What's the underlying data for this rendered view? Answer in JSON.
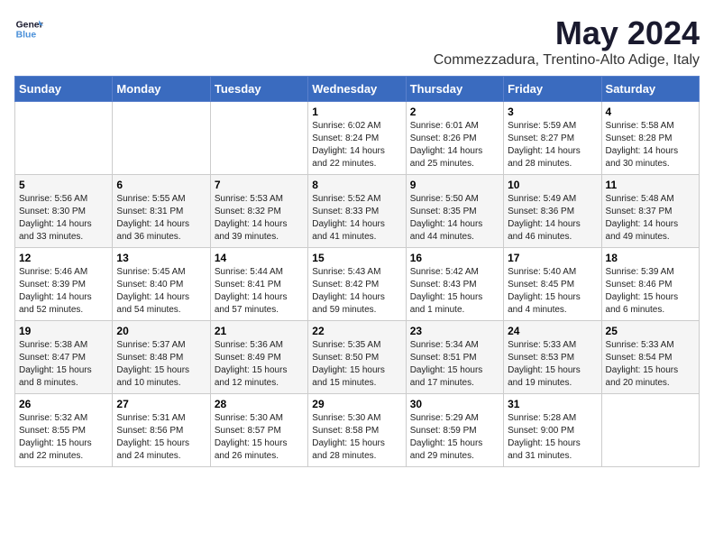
{
  "logo": {
    "line1": "General",
    "line2": "Blue"
  },
  "title": {
    "month": "May 2024",
    "location": "Commezzadura, Trentino-Alto Adige, Italy"
  },
  "days_header": [
    "Sunday",
    "Monday",
    "Tuesday",
    "Wednesday",
    "Thursday",
    "Friday",
    "Saturday"
  ],
  "weeks": [
    [
      {
        "day": "",
        "info": ""
      },
      {
        "day": "",
        "info": ""
      },
      {
        "day": "",
        "info": ""
      },
      {
        "day": "1",
        "info": "Sunrise: 6:02 AM\nSunset: 8:24 PM\nDaylight: 14 hours and 22 minutes."
      },
      {
        "day": "2",
        "info": "Sunrise: 6:01 AM\nSunset: 8:26 PM\nDaylight: 14 hours and 25 minutes."
      },
      {
        "day": "3",
        "info": "Sunrise: 5:59 AM\nSunset: 8:27 PM\nDaylight: 14 hours and 28 minutes."
      },
      {
        "day": "4",
        "info": "Sunrise: 5:58 AM\nSunset: 8:28 PM\nDaylight: 14 hours and 30 minutes."
      }
    ],
    [
      {
        "day": "5",
        "info": "Sunrise: 5:56 AM\nSunset: 8:30 PM\nDaylight: 14 hours and 33 minutes."
      },
      {
        "day": "6",
        "info": "Sunrise: 5:55 AM\nSunset: 8:31 PM\nDaylight: 14 hours and 36 minutes."
      },
      {
        "day": "7",
        "info": "Sunrise: 5:53 AM\nSunset: 8:32 PM\nDaylight: 14 hours and 39 minutes."
      },
      {
        "day": "8",
        "info": "Sunrise: 5:52 AM\nSunset: 8:33 PM\nDaylight: 14 hours and 41 minutes."
      },
      {
        "day": "9",
        "info": "Sunrise: 5:50 AM\nSunset: 8:35 PM\nDaylight: 14 hours and 44 minutes."
      },
      {
        "day": "10",
        "info": "Sunrise: 5:49 AM\nSunset: 8:36 PM\nDaylight: 14 hours and 46 minutes."
      },
      {
        "day": "11",
        "info": "Sunrise: 5:48 AM\nSunset: 8:37 PM\nDaylight: 14 hours and 49 minutes."
      }
    ],
    [
      {
        "day": "12",
        "info": "Sunrise: 5:46 AM\nSunset: 8:39 PM\nDaylight: 14 hours and 52 minutes."
      },
      {
        "day": "13",
        "info": "Sunrise: 5:45 AM\nSunset: 8:40 PM\nDaylight: 14 hours and 54 minutes."
      },
      {
        "day": "14",
        "info": "Sunrise: 5:44 AM\nSunset: 8:41 PM\nDaylight: 14 hours and 57 minutes."
      },
      {
        "day": "15",
        "info": "Sunrise: 5:43 AM\nSunset: 8:42 PM\nDaylight: 14 hours and 59 minutes."
      },
      {
        "day": "16",
        "info": "Sunrise: 5:42 AM\nSunset: 8:43 PM\nDaylight: 15 hours and 1 minute."
      },
      {
        "day": "17",
        "info": "Sunrise: 5:40 AM\nSunset: 8:45 PM\nDaylight: 15 hours and 4 minutes."
      },
      {
        "day": "18",
        "info": "Sunrise: 5:39 AM\nSunset: 8:46 PM\nDaylight: 15 hours and 6 minutes."
      }
    ],
    [
      {
        "day": "19",
        "info": "Sunrise: 5:38 AM\nSunset: 8:47 PM\nDaylight: 15 hours and 8 minutes."
      },
      {
        "day": "20",
        "info": "Sunrise: 5:37 AM\nSunset: 8:48 PM\nDaylight: 15 hours and 10 minutes."
      },
      {
        "day": "21",
        "info": "Sunrise: 5:36 AM\nSunset: 8:49 PM\nDaylight: 15 hours and 12 minutes."
      },
      {
        "day": "22",
        "info": "Sunrise: 5:35 AM\nSunset: 8:50 PM\nDaylight: 15 hours and 15 minutes."
      },
      {
        "day": "23",
        "info": "Sunrise: 5:34 AM\nSunset: 8:51 PM\nDaylight: 15 hours and 17 minutes."
      },
      {
        "day": "24",
        "info": "Sunrise: 5:33 AM\nSunset: 8:53 PM\nDaylight: 15 hours and 19 minutes."
      },
      {
        "day": "25",
        "info": "Sunrise: 5:33 AM\nSunset: 8:54 PM\nDaylight: 15 hours and 20 minutes."
      }
    ],
    [
      {
        "day": "26",
        "info": "Sunrise: 5:32 AM\nSunset: 8:55 PM\nDaylight: 15 hours and 22 minutes."
      },
      {
        "day": "27",
        "info": "Sunrise: 5:31 AM\nSunset: 8:56 PM\nDaylight: 15 hours and 24 minutes."
      },
      {
        "day": "28",
        "info": "Sunrise: 5:30 AM\nSunset: 8:57 PM\nDaylight: 15 hours and 26 minutes."
      },
      {
        "day": "29",
        "info": "Sunrise: 5:30 AM\nSunset: 8:58 PM\nDaylight: 15 hours and 28 minutes."
      },
      {
        "day": "30",
        "info": "Sunrise: 5:29 AM\nSunset: 8:59 PM\nDaylight: 15 hours and 29 minutes."
      },
      {
        "day": "31",
        "info": "Sunrise: 5:28 AM\nSunset: 9:00 PM\nDaylight: 15 hours and 31 minutes."
      },
      {
        "day": "",
        "info": ""
      }
    ]
  ]
}
